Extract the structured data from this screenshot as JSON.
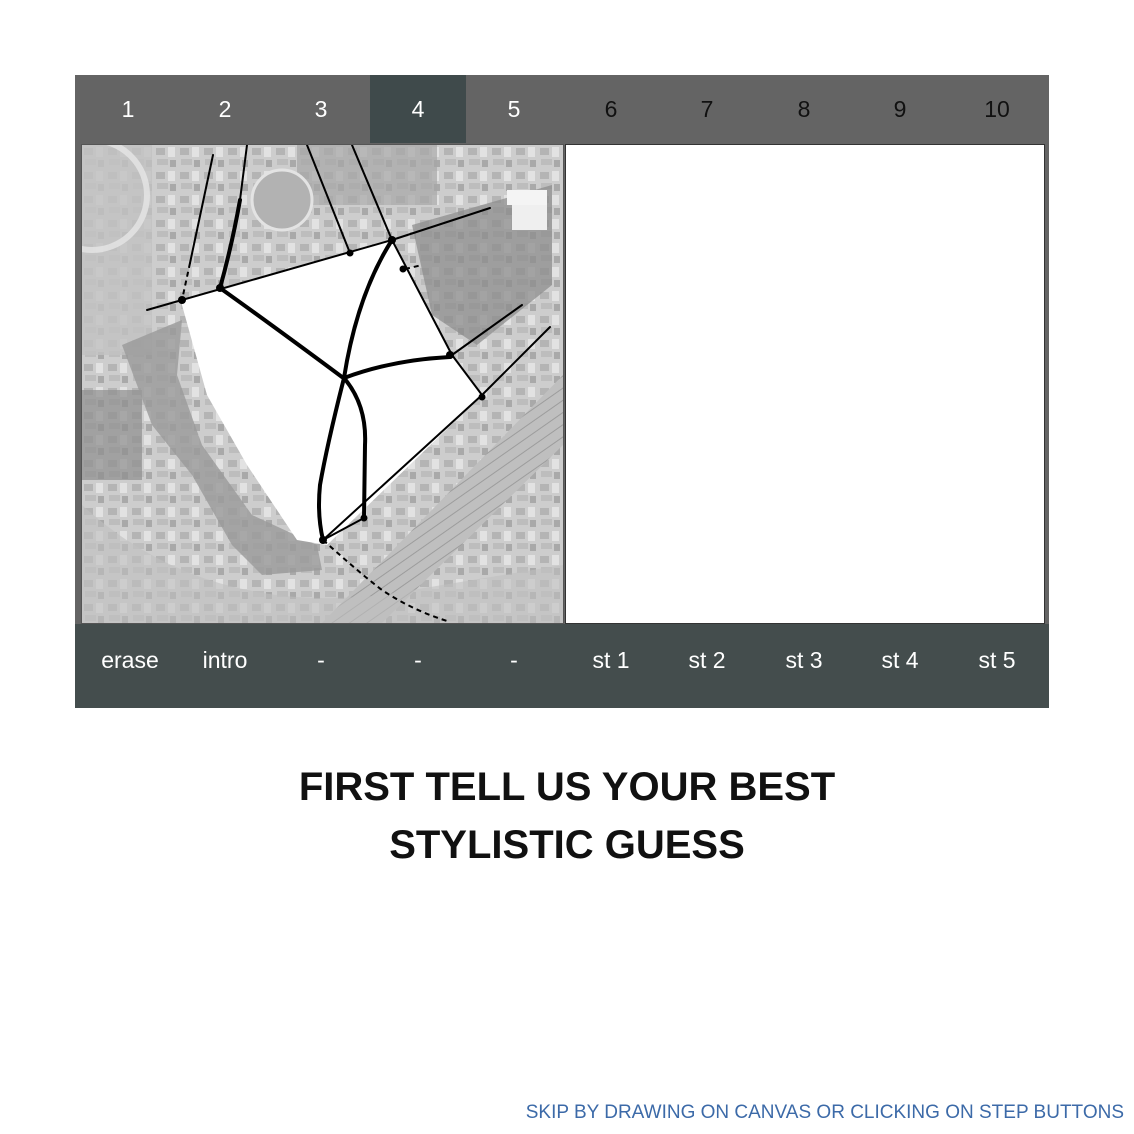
{
  "step_tabs": [
    {
      "label": "1",
      "state": "normal"
    },
    {
      "label": "2",
      "state": "normal"
    },
    {
      "label": "3",
      "state": "normal"
    },
    {
      "label": "4",
      "state": "active"
    },
    {
      "label": "5",
      "state": "normal"
    },
    {
      "label": "6",
      "state": "dark"
    },
    {
      "label": "7",
      "state": "dark"
    },
    {
      "label": "8",
      "state": "dark"
    },
    {
      "label": "9",
      "state": "dark"
    },
    {
      "label": "10",
      "state": "dark"
    }
  ],
  "bottom_buttons": [
    "erase",
    "intro",
    "-",
    "-",
    "-",
    "st 1",
    "st 2",
    "st 3",
    "st 4",
    "st 5"
  ],
  "instruction": {
    "line1": "FIRST TELL US YOUR BEST",
    "line2": "STYLISTIC GUESS"
  },
  "skip_hint": "SKIP BY DRAWING ON CANVAS OR CLICKING ON STEP BUTTONS",
  "colors": {
    "bar_gray": "#646464",
    "active_tab": "#3f4a4b",
    "bottom_bar": "#444d4d",
    "hint_blue": "#3c6aa8"
  }
}
